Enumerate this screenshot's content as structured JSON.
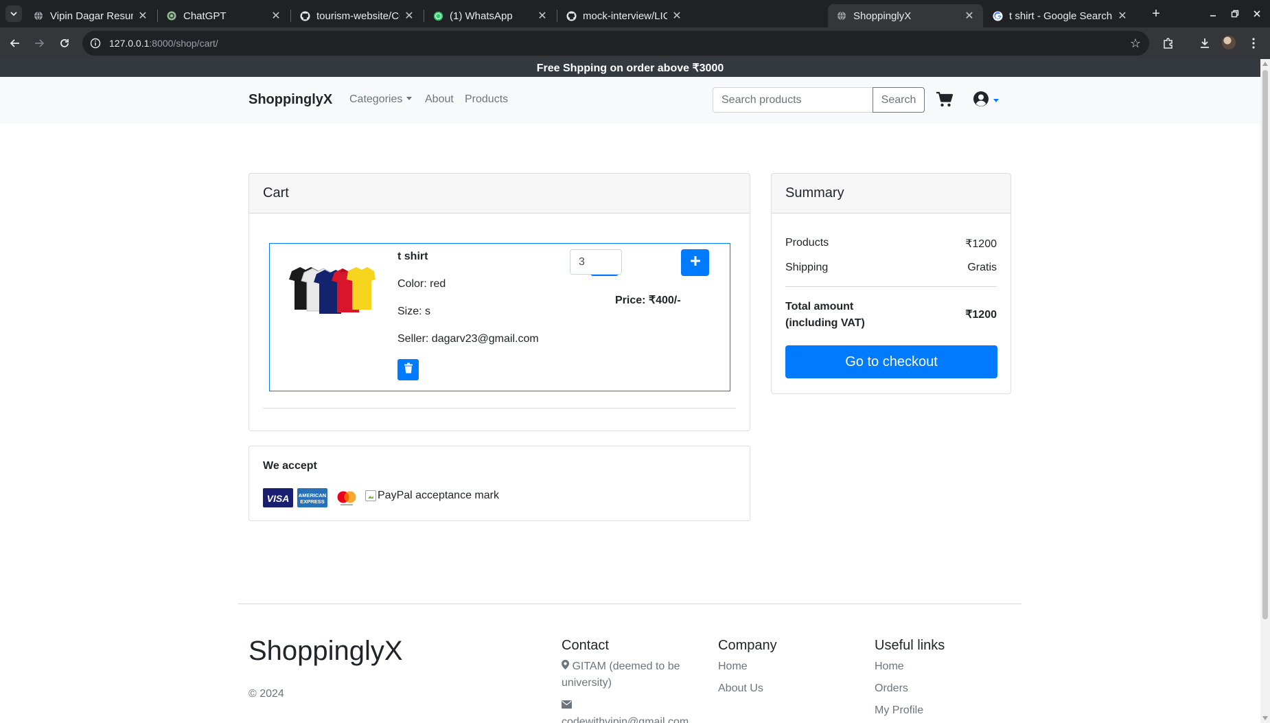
{
  "browser": {
    "tabs": [
      {
        "title": "Vipin Dagar Resume - G",
        "favicon": "globe-icon",
        "active": false
      },
      {
        "title": "ChatGPT",
        "favicon": "chatgpt-icon",
        "active": false
      },
      {
        "title": "tourism-website/CONTI",
        "favicon": "github-icon",
        "active": false
      },
      {
        "title": "(1) WhatsApp",
        "favicon": "whatsapp-icon",
        "active": false
      },
      {
        "title": "mock-interview/LICENS",
        "favicon": "github-icon",
        "active": false
      },
      {
        "title": "ShoppinglyX",
        "favicon": "globe-icon",
        "active": true
      },
      {
        "title": "t shirt - Google Search",
        "favicon": "google-icon",
        "active": false
      }
    ],
    "url_host": "127.0.0.1",
    "url_rest": ":8000/shop/cart/"
  },
  "promo": {
    "text": "Free Shpping on order above ₹3000"
  },
  "navbar": {
    "brand": "ShoppinglyX",
    "links": {
      "categories": "Categories",
      "about": "About",
      "products": "Products"
    },
    "search_placeholder": "Search products",
    "search_button": "Search"
  },
  "cart": {
    "header": "Cart",
    "items": [
      {
        "name": "t shirt",
        "color": "Color: red",
        "size": "Size: s",
        "seller": "Seller: dagarv23@gmail.com",
        "quantity": "3",
        "price": "Price: ₹400/-"
      }
    ]
  },
  "accept": {
    "title": "We accept",
    "visa": "VISA",
    "amex_top": "AMERICAN",
    "amex_bottom": "EXPRESS",
    "paypal_alt": "PayPal acceptance mark"
  },
  "summary": {
    "header": "Summary",
    "products_label": "Products",
    "products_value": "₹1200",
    "shipping_label": "Shipping",
    "shipping_value": "Gratis",
    "total_label": "Total amount (including VAT)",
    "total_value": "₹1200",
    "checkout": "Go to checkout"
  },
  "footer": {
    "brand": "ShoppinglyX",
    "copyright": "© 2024",
    "contact_title": "Contact",
    "contact_address": "GITAM (deemed to be university)",
    "contact_email": "codewithvipin@gmail.com",
    "company_title": "Company",
    "company_links": [
      "Home",
      "About Us"
    ],
    "useful_title": "Useful links",
    "useful_links": [
      "Home",
      "Orders",
      "My Profile"
    ]
  },
  "colors": {
    "primary": "#007bff",
    "dark": "#343a40",
    "light": "#f8f9fa",
    "muted": "#6c757d"
  }
}
